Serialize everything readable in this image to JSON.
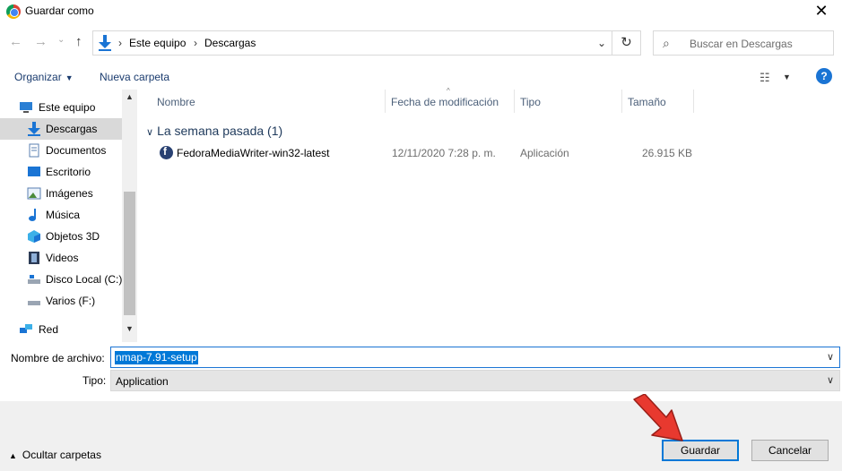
{
  "window": {
    "title": "Guardar como",
    "close_glyph": "✕"
  },
  "nav": {
    "back_glyph": "←",
    "forward_glyph": "→",
    "recent_glyph": "⌄",
    "up_glyph": "↑",
    "breadcrumbs": [
      "Este equipo",
      "Descargas"
    ],
    "separator": "›",
    "dropdown_glyph": "⌄",
    "refresh_glyph": "↻",
    "search_placeholder": "Buscar en Descargas",
    "search_glyph": "⌕"
  },
  "toolbar": {
    "organize_label": "Organizar",
    "caret": "▼",
    "new_folder_label": "Nueva carpeta",
    "view_glyph": "☷",
    "help_glyph": "?"
  },
  "sidebar": {
    "items": [
      {
        "label": "Este equipo",
        "icon": "computer-icon"
      },
      {
        "label": "Descargas",
        "icon": "downloads-icon",
        "selected": true
      },
      {
        "label": "Documentos",
        "icon": "documents-icon"
      },
      {
        "label": "Escritorio",
        "icon": "desktop-icon"
      },
      {
        "label": "Imágenes",
        "icon": "pictures-icon"
      },
      {
        "label": "Música",
        "icon": "music-icon"
      },
      {
        "label": "Objetos 3D",
        "icon": "3d-objects-icon"
      },
      {
        "label": "Videos",
        "icon": "videos-icon"
      },
      {
        "label": "Disco Local (C:)",
        "icon": "local-disk-icon"
      },
      {
        "label": "Varios (F:)",
        "icon": "drive-icon"
      },
      {
        "label": "Red",
        "icon": "network-icon"
      }
    ],
    "scroll_up": "▲",
    "scroll_down": "▼"
  },
  "columns": {
    "name": "Nombre",
    "date": "Fecha de modificación",
    "type": "Tipo",
    "size": "Tamaño",
    "sort_glyph": "^"
  },
  "group": {
    "label": "La semana pasada (1)",
    "chevron": "∨"
  },
  "files": [
    {
      "name": "FedoraMediaWriter-win32-latest",
      "date": "12/11/2020 7:28 p. m.",
      "type": "Aplicación",
      "size": "26.915 KB"
    }
  ],
  "form": {
    "filename_label": "Nombre de archivo:",
    "filename_value": "nmap-7.91-setup",
    "type_label": "Tipo:",
    "type_value": "Application",
    "dropdown_glyph": "∨"
  },
  "footer": {
    "hide_folders_label": "Ocultar carpetas",
    "caret": "▲",
    "save_label": "Guardar",
    "cancel_label": "Cancelar"
  },
  "colors": {
    "accent": "#0078d7",
    "selection": "#cce8ff",
    "annotation_arrow": "#e8392f"
  }
}
